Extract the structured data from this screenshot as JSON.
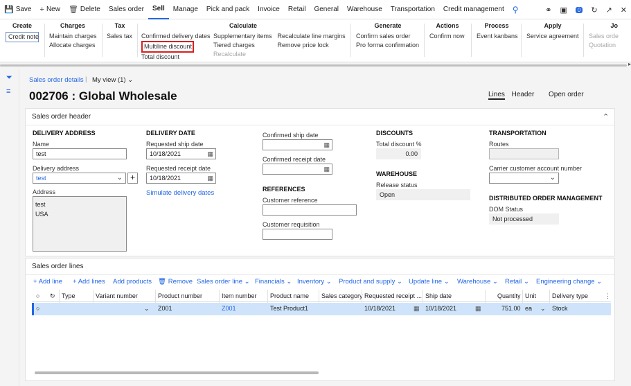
{
  "menubar": {
    "save": "Save",
    "new": "New",
    "delete": "Delete",
    "tabs": [
      "Sales order",
      "Sell",
      "Manage",
      "Pick and pack",
      "Invoice",
      "Retail",
      "General",
      "Warehouse",
      "Transportation",
      "Credit management"
    ],
    "active_tab": "Sell",
    "notification_count": "0"
  },
  "ribbon": {
    "groups": [
      {
        "title": "Create",
        "items": [
          "Credit note"
        ]
      },
      {
        "title": "Charges",
        "items": [
          "Maintain charges",
          "Allocate charges"
        ]
      },
      {
        "title": "Tax",
        "items": [
          "Sales tax"
        ]
      },
      {
        "title": "Calculate",
        "col1": [
          "Confirmed delivery dates",
          "Multiline discount",
          "Total discount"
        ],
        "col2": [
          "Supplementary items",
          "Tiered charges",
          "Recalculate"
        ],
        "col3": [
          "Recalculate line margins",
          "Remove price lock"
        ]
      },
      {
        "title": "Generate",
        "items": [
          "Confirm sales order",
          "Pro forma confirmation"
        ]
      },
      {
        "title": "Actions",
        "items": [
          "Confirm now"
        ]
      },
      {
        "title": "Process",
        "items": [
          "Event kanbans"
        ]
      },
      {
        "title": "Apply",
        "items": [
          "Service agreement"
        ]
      },
      {
        "title": "Jo",
        "items": [
          "Sales orde",
          "Quotation"
        ]
      }
    ]
  },
  "page": {
    "breadcrumb": "Sales order details",
    "view": "My view (1)",
    "title": "002706 : Global Wholesale",
    "tabs": [
      "Lines",
      "Header",
      "Open order"
    ]
  },
  "header_panel": {
    "title": "Sales order header",
    "delivery_address": {
      "heading": "DELIVERY ADDRESS",
      "name_label": "Name",
      "name_value": "test",
      "address_label": "Delivery address",
      "address_value": "test",
      "address_block_label": "Address",
      "address_line1": "test",
      "address_line2": "USA"
    },
    "delivery_date": {
      "heading": "DELIVERY DATE",
      "ship_label": "Requested ship date",
      "ship_value": "10/18/2021",
      "receipt_label": "Requested receipt date",
      "receipt_value": "10/18/2021",
      "simulate": "Simulate delivery dates"
    },
    "confirmed": {
      "ship_label": "Confirmed ship date",
      "receipt_label": "Confirmed receipt date"
    },
    "references": {
      "heading": "REFERENCES",
      "customer_ref_label": "Customer reference",
      "customer_req_label": "Customer requisition"
    },
    "discounts": {
      "heading": "DISCOUNTS",
      "total_label": "Total discount %",
      "total_value": "0.00"
    },
    "warehouse": {
      "heading": "WAREHOUSE",
      "release_label": "Release status",
      "release_value": "Open"
    },
    "transportation": {
      "heading": "TRANSPORTATION",
      "routes_label": "Routes",
      "carrier_label": "Carrier customer account number"
    },
    "dom": {
      "heading": "DISTRIBUTED ORDER MANAGEMENT",
      "status_label": "DOM Status",
      "status_value": "Not processed"
    }
  },
  "lines_panel": {
    "title": "Sales order lines",
    "toolbar": [
      "Add line",
      "Add lines",
      "Add products",
      "Remove",
      "Sales order line",
      "Financials",
      "Inventory",
      "Product and supply",
      "Update line",
      "Warehouse",
      "Retail",
      "Engineering change"
    ],
    "columns": [
      "Type",
      "Variant number",
      "Product number",
      "Item number",
      "Product name",
      "Sales category",
      "Requested receipt ...",
      "Ship date",
      "Quantity",
      "Unit",
      "Delivery type"
    ],
    "rows": [
      {
        "product_number": "Z001",
        "item_number": "Z001",
        "product_name": "Test Product1",
        "receipt": "10/18/2021",
        "ship": "10/18/2021",
        "quantity": "751.00",
        "unit": "ea",
        "delivery_type": "Stock"
      }
    ]
  }
}
